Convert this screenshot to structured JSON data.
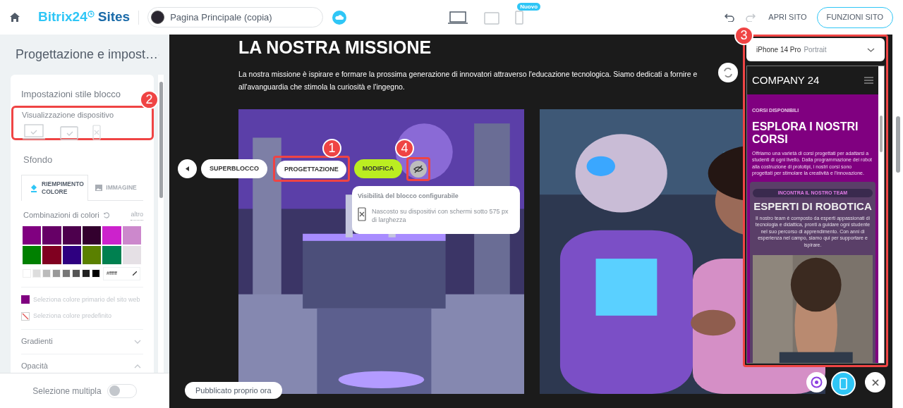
{
  "topbar": {
    "logo_brand": "Bitrix24",
    "logo_suffix": "Sites",
    "page_selector": "Pagina Principale (copia)",
    "devices": [
      {
        "kind": "desktop",
        "selected": true
      },
      {
        "kind": "tablet",
        "selected": false
      },
      {
        "kind": "mobile",
        "selected": false,
        "badge": "Nuovo"
      }
    ],
    "open_site": "APRI SITO",
    "site_functions": "FUNZIONI SITO"
  },
  "sidebar": {
    "title": "Progettazione e impost…",
    "section_title": "Impostazioni stile blocco",
    "device_view": {
      "label": "Visualizzazione dispositivo",
      "devices": [
        {
          "kind": "desktop",
          "visible": true
        },
        {
          "kind": "tablet",
          "visible": true
        },
        {
          "kind": "mobile",
          "visible": false
        }
      ]
    },
    "background": {
      "title": "Sfondo",
      "tabs": [
        {
          "label": "RIEMPIMENTO COLORE",
          "selected": true
        },
        {
          "label": "IMMAGINE",
          "selected": false
        }
      ],
      "combos_label": "Combinazioni di colori",
      "more_link": "altro",
      "swatches": [
        {
          "color": "#800080"
        },
        {
          "color": "#660066"
        },
        {
          "color": "#4d004d"
        },
        {
          "color": "#33002e"
        },
        {
          "color": "#cc22cc"
        },
        {
          "color": "#cc88cc"
        },
        {
          "color": "#008000"
        },
        {
          "color": "#800020"
        },
        {
          "color": "#2e0080"
        },
        {
          "color": "#5a8000"
        },
        {
          "color": "#008050"
        },
        {
          "color": "#e5e0e5"
        }
      ],
      "grays": [
        {
          "color": "#ffffff"
        },
        {
          "color": "#dddddd"
        },
        {
          "color": "#bbbbbb"
        },
        {
          "color": "#999999"
        },
        {
          "color": "#777777"
        },
        {
          "color": "#555555"
        },
        {
          "color": "#222222"
        },
        {
          "color": "#000000"
        }
      ],
      "hex_value": "#ffffff",
      "primary_option": "Seleziona colore primario del sito web",
      "default_option": "Seleziona colore predefinito"
    },
    "accordions": [
      {
        "label": "Gradienti",
        "expanded": false
      },
      {
        "label": "Opacità",
        "expanded": true
      }
    ],
    "multi_select": {
      "label": "Selezione multipla",
      "on": false
    }
  },
  "canvas": {
    "heading": "LA NOSTRA MISSIONE",
    "paragraph_lines": [
      "La nostra missione è ispirare e formare la prossima generazione di innovatori attraverso l'educazione tecnologica. Siamo dedicati a fornire e",
      "all'avanguardia che stimola la curiosità e l'ingegno."
    ],
    "block_toolbar": [
      "SUPERBLOCCO",
      "PROGETTAZIONE",
      "MODIFICA"
    ],
    "tooltip": {
      "title": "Visibilità del blocco configurabile",
      "text": "Nascosto su dispositivi con schermi sotto 575 px di larghezza"
    },
    "status": "Pubblicato proprio ora"
  },
  "preview": {
    "device": "iPhone 14 Pro",
    "orientation": "Portrait",
    "logo": "COMPANY 24",
    "eyebrow": "CORSI DISPONIBILI",
    "heading": "ESPLORA I NOSTRI CORSI",
    "text": "Offriamo una varietà di corsi progettati per adattarsi a studenti di ogni livello. Dalla programmazione dei robot alla costruzione di prototipi, i nostri corsi sono progettati per stimolare la creatività e l'innovazione.",
    "team_eyebrow": "INCONTRA IL NOSTRO TEAM",
    "team_heading": "ESPERTI DI ROBOTICA",
    "team_text": "Il nostro team è composto da esperti appassionati di tecnologia e didattica, pronti a guidare ogni studente nel suo percorso di apprendimento. Con anni di esperienza nel campo, siamo qui per supportare e ispirare."
  },
  "callouts": [
    "1",
    "2",
    "3",
    "4"
  ]
}
